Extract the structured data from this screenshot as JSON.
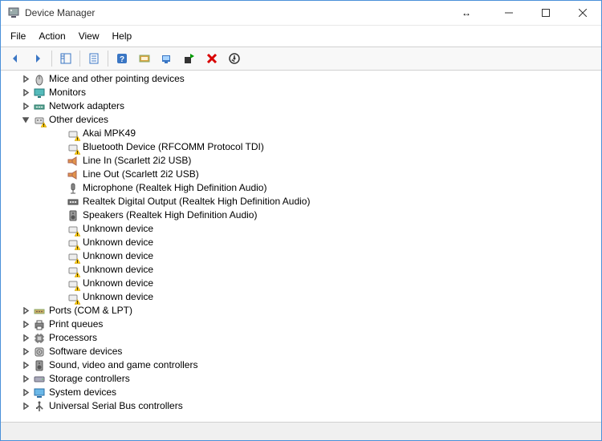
{
  "window": {
    "title": "Device Manager"
  },
  "menu": {
    "file": "File",
    "action": "Action",
    "view": "View",
    "help": "Help"
  },
  "tree": {
    "indent_base": 24,
    "indent_child": 42,
    "items": [
      {
        "label": "Mice and other pointing devices",
        "icon": "mouse",
        "level": 0,
        "expander": "collapsed"
      },
      {
        "label": "Monitors",
        "icon": "monitor",
        "level": 0,
        "expander": "collapsed"
      },
      {
        "label": "Network adapters",
        "icon": "network",
        "level": 0,
        "expander": "collapsed"
      },
      {
        "label": "Other devices",
        "icon": "other",
        "level": 0,
        "expander": "expanded",
        "warn": true
      },
      {
        "label": "Akai MPK49",
        "icon": "generic",
        "level": 1,
        "warn": true
      },
      {
        "label": "Bluetooth Device (RFCOMM Protocol TDI)",
        "icon": "generic",
        "level": 1,
        "warn": true
      },
      {
        "label": "Line In (Scarlett 2i2 USB)",
        "icon": "audio",
        "level": 1
      },
      {
        "label": "Line Out (Scarlett 2i2 USB)",
        "icon": "audio",
        "level": 1
      },
      {
        "label": "Microphone (Realtek High Definition Audio)",
        "icon": "mic",
        "level": 1
      },
      {
        "label": "Realtek Digital Output (Realtek High Definition Audio)",
        "icon": "digital",
        "level": 1
      },
      {
        "label": "Speakers (Realtek High Definition Audio)",
        "icon": "speaker",
        "level": 1
      },
      {
        "label": "Unknown device",
        "icon": "generic",
        "level": 1,
        "warn": true
      },
      {
        "label": "Unknown device",
        "icon": "generic",
        "level": 1,
        "warn": true
      },
      {
        "label": "Unknown device",
        "icon": "generic",
        "level": 1,
        "warn": true
      },
      {
        "label": "Unknown device",
        "icon": "generic",
        "level": 1,
        "warn": true
      },
      {
        "label": "Unknown device",
        "icon": "generic",
        "level": 1,
        "warn": true
      },
      {
        "label": "Unknown device",
        "icon": "generic",
        "level": 1,
        "warn": true
      },
      {
        "label": "Ports (COM & LPT)",
        "icon": "ports",
        "level": 0,
        "expander": "collapsed"
      },
      {
        "label": "Print queues",
        "icon": "printer",
        "level": 0,
        "expander": "collapsed"
      },
      {
        "label": "Processors",
        "icon": "cpu",
        "level": 0,
        "expander": "collapsed"
      },
      {
        "label": "Software devices",
        "icon": "software",
        "level": 0,
        "expander": "collapsed"
      },
      {
        "label": "Sound, video and game controllers",
        "icon": "speaker",
        "level": 0,
        "expander": "collapsed"
      },
      {
        "label": "Storage controllers",
        "icon": "storage",
        "level": 0,
        "expander": "collapsed"
      },
      {
        "label": "System devices",
        "icon": "system",
        "level": 0,
        "expander": "collapsed"
      },
      {
        "label": "Universal Serial Bus controllers",
        "icon": "usb",
        "level": 0,
        "expander": "collapsed"
      }
    ]
  },
  "colors": {
    "accent": "#0078d7",
    "warn_triangle": "#ffcc00",
    "remove_x": "#d90000",
    "install_flag": "#009a00"
  }
}
